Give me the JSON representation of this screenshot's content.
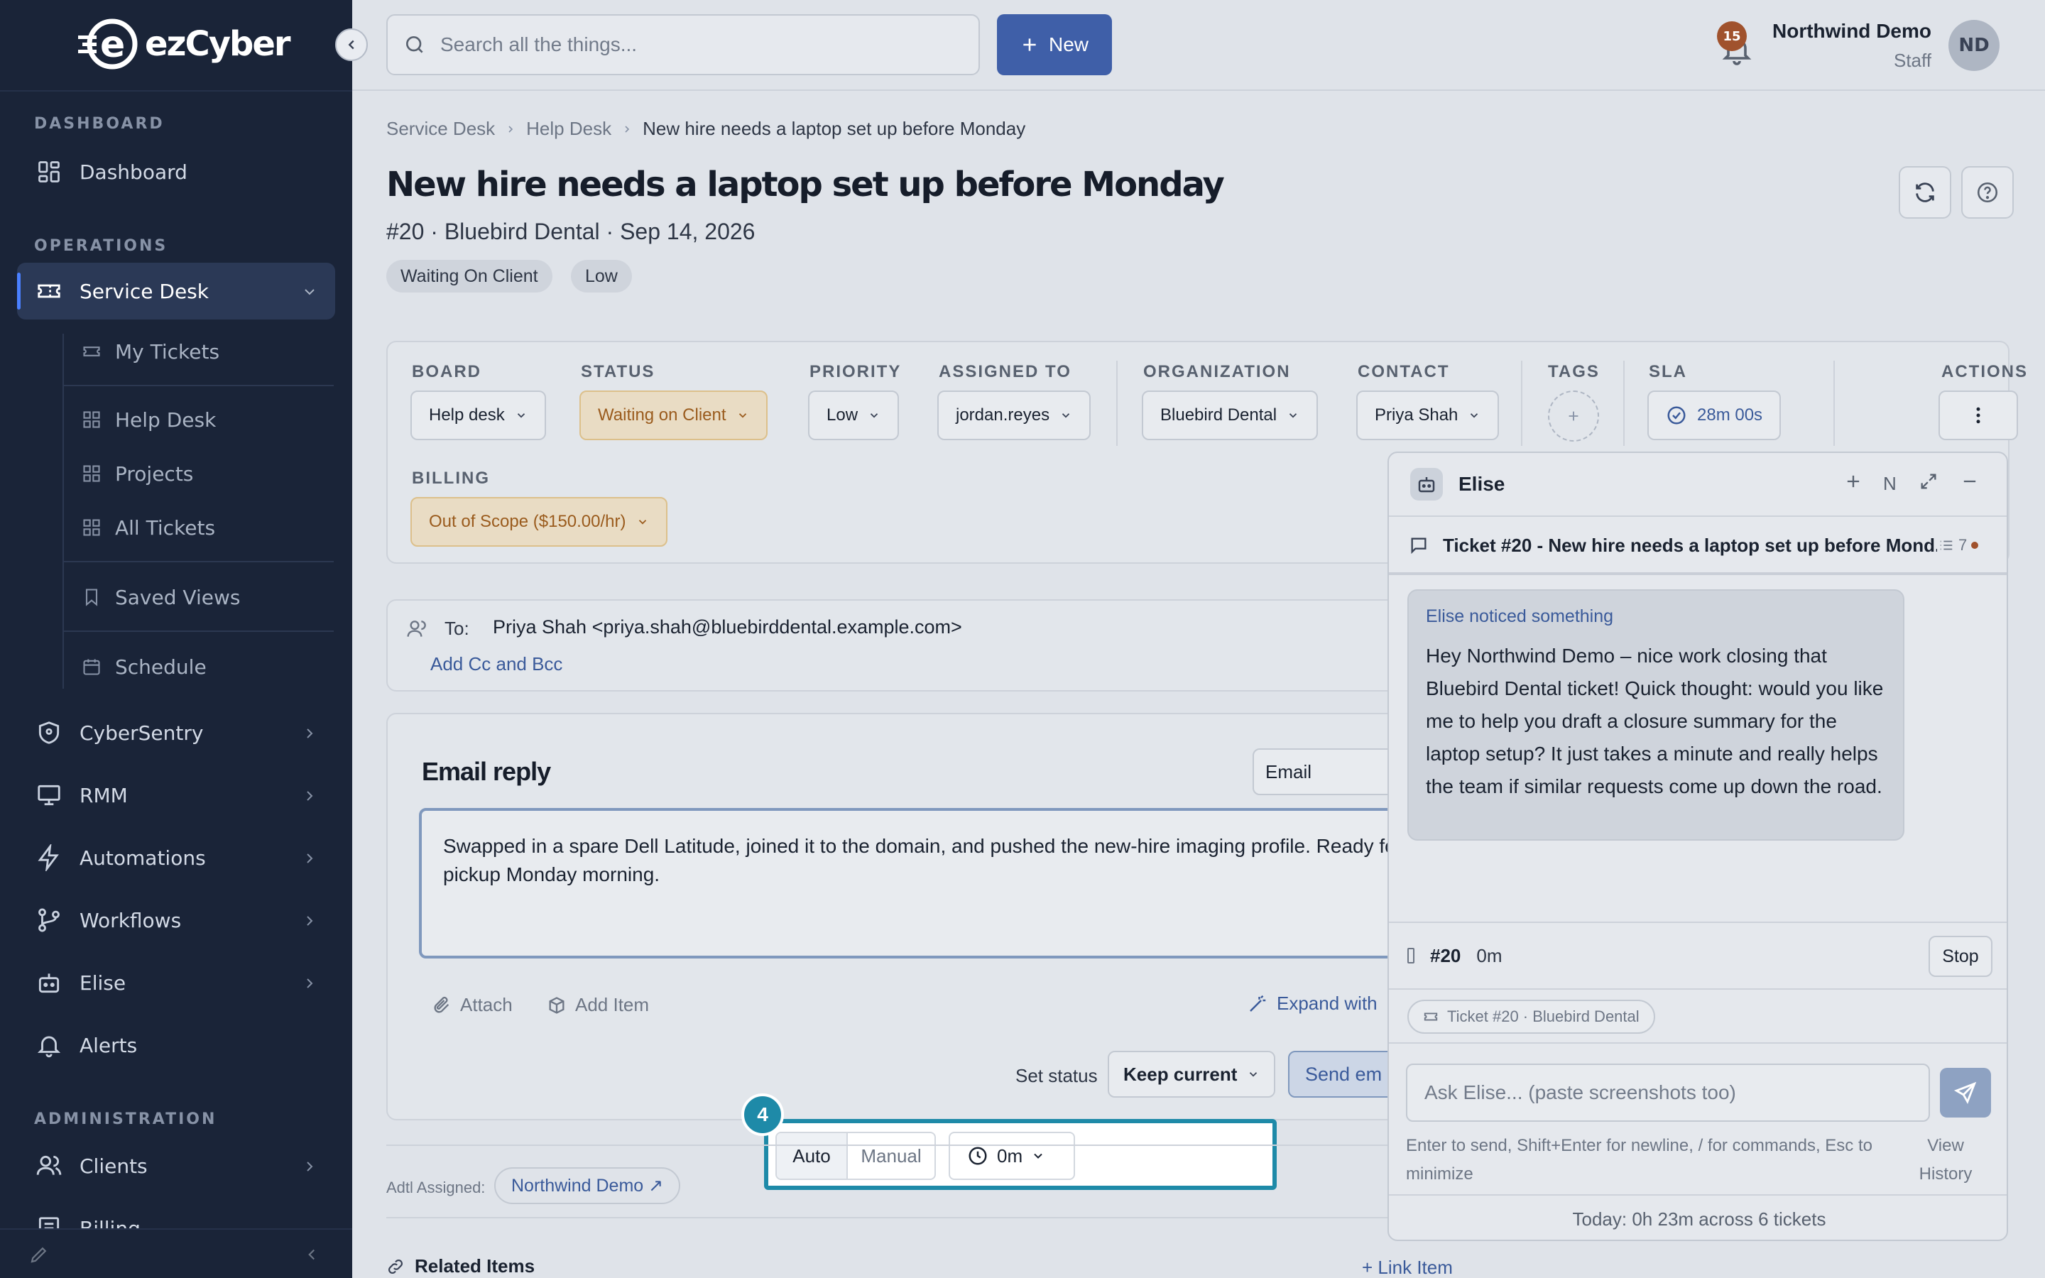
{
  "app": {
    "brand": "ezCyber",
    "accent": "#3f5fa8",
    "highlight": "#1e8aa8"
  },
  "sidebar": {
    "sections": {
      "dashboard": "DASHBOARD",
      "operations": "OPERATIONS",
      "administration": "ADMINISTRATION"
    },
    "items": {
      "dashboard": "Dashboard",
      "service_desk": "Service Desk",
      "my_tickets": "My Tickets",
      "help_desk": "Help Desk",
      "projects": "Projects",
      "all_tickets": "All Tickets",
      "saved_views": "Saved Views",
      "schedule": "Schedule",
      "cybersentry": "CyberSentry",
      "rmm": "RMM",
      "automations": "Automations",
      "workflows": "Workflows",
      "elise": "Elise",
      "alerts": "Alerts",
      "clients": "Clients",
      "billing": "Billing"
    }
  },
  "topbar": {
    "search_placeholder": "Search all the things...",
    "new_label": "New",
    "notifications_count": "15",
    "user_name": "Northwind Demo",
    "user_role": "Staff",
    "user_initials": "ND"
  },
  "breadcrumb": [
    "Service Desk",
    "Help Desk",
    "New hire needs a laptop set up before Monday"
  ],
  "ticket": {
    "title": "New hire needs a laptop set up before Monday",
    "subtitle": "#20 · Bluebird Dental · Sep 14, 2026",
    "status_pill": "Waiting On Client",
    "priority_pill": "Low"
  },
  "fields": {
    "board": {
      "label": "BOARD",
      "value": "Help desk"
    },
    "status": {
      "label": "STATUS",
      "value": "Waiting on Client"
    },
    "priority": {
      "label": "PRIORITY",
      "value": "Low"
    },
    "assigned": {
      "label": "ASSIGNED TO",
      "value": "jordan.reyes"
    },
    "organization": {
      "label": "ORGANIZATION",
      "value": "Bluebird Dental"
    },
    "contact": {
      "label": "CONTACT",
      "value": "Priya Shah"
    },
    "tags": {
      "label": "TAGS"
    },
    "sla": {
      "label": "SLA",
      "value": "28m 00s"
    },
    "actions": {
      "label": "ACTIONS"
    },
    "billing": {
      "label": "BILLING",
      "value": "Out of Scope ($150.00/hr)"
    }
  },
  "email": {
    "to_label": "To:",
    "to_value": "Priya Shah <priya.shah@bluebirddental.example.com>",
    "add_cc": "Add Cc and Bcc",
    "reply_title": "Email reply",
    "channel": "Email",
    "body": "Swapped in a spare Dell Latitude, joined it to the domain, and pushed the new-hire imaging profile. Ready for pickup Monday morning.",
    "attach": "Attach",
    "add_item": "Add Item",
    "expand": "Expand with",
    "time_auto": "Auto",
    "time_manual": "Manual",
    "time_value": "0m",
    "set_status_label": "Set status",
    "set_status_value": "Keep current",
    "send": "Send em",
    "step_number": "4"
  },
  "below": {
    "addl_label": "Adtl Assigned:",
    "addl_value": "Northwind Demo ↗",
    "related": "Related Items",
    "link_item": "+ Link Item"
  },
  "elise": {
    "title": "Elise",
    "ctrl_new_label": "N",
    "ticket_title": "Ticket #20 - New hire needs a laptop set up before Mond...",
    "ticket_count": "7",
    "notice": "Elise noticed something",
    "message": "Hey Northwind Demo – nice work closing that Bluebird Dental ticket! Quick thought: would you like me to help you draft a closure summary for the laptop setup? It just takes a minute and really helps the team if similar requests come up down the road.",
    "timer_ticket": "#20",
    "timer_value": "0m",
    "stop": "Stop",
    "context_chip": "Ticket #20 · Bluebird Dental",
    "input_placeholder": "Ask Elise... (paste screenshots too)",
    "hint": "Enter to send, Shift+Enter for newline, / for commands, Esc to minimize",
    "view_history": "View History",
    "footer": "Today: 0h 23m across 6 tickets"
  }
}
